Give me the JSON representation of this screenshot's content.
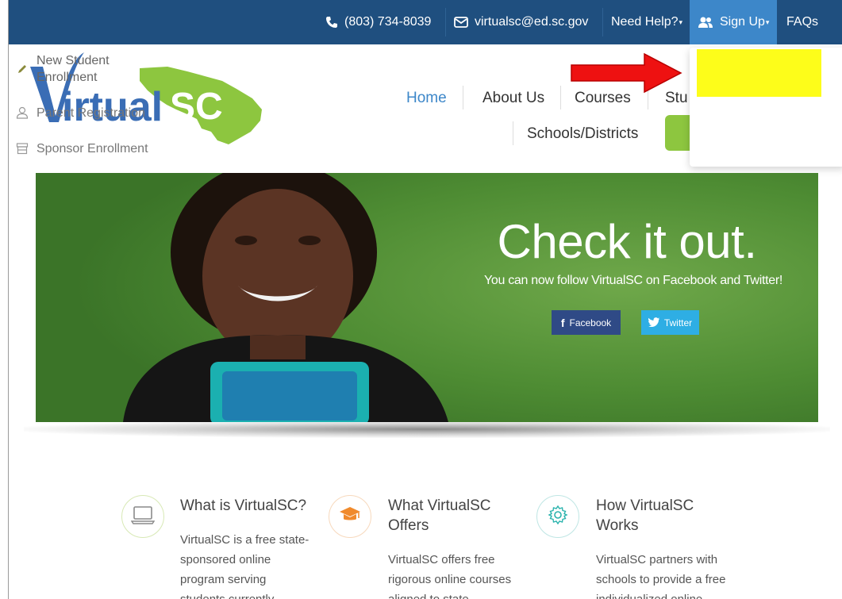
{
  "topbar": {
    "phone": "(803) 734-8039",
    "email": "virtualsc@ed.sc.gov",
    "help": "Need Help?",
    "signup": "Sign Up",
    "faqs": "FAQs"
  },
  "logo": {
    "text_v": "V",
    "text_rest": "irtual",
    "text_sc": "SC"
  },
  "nav": {
    "home": "Home",
    "about": "About Us",
    "courses": "Courses",
    "students": "Stu",
    "schools": "Schools/Districts"
  },
  "dropdown": {
    "new_student": "New Student Enrollment",
    "new_student_l1": "New Student",
    "new_student_l2": "Enrollment",
    "parent": "Parent Registration",
    "sponsor": "Sponsor Enrollment"
  },
  "hero": {
    "title": "Check it out.",
    "subtitle": "You can now follow VirtualSC on Facebook and Twitter!",
    "facebook": "Facebook",
    "twitter": "Twitter"
  },
  "features": [
    {
      "title": "What is VirtualSC?",
      "lines": [
        "VirtualSC is a free state-",
        "sponsored online",
        "program serving",
        "students currently"
      ]
    },
    {
      "title_l1": "What VirtualSC",
      "title_l2": "Offers",
      "lines": [
        "VirtualSC offers free",
        "rigorous online courses",
        "aligned to state"
      ]
    },
    {
      "title_l1": "How VirtualSC",
      "title_l2": "Works",
      "lines": [
        "VirtualSC partners with",
        "schools to provide a free",
        "individualized online"
      ]
    }
  ],
  "colors": {
    "topbar": "#1f4f7f",
    "signup_active": "#3d87c9",
    "logo_blue": "#3a6db5",
    "logo_green": "#8dc63f",
    "highlight": "#fdfd1a",
    "arrow": "#ee1111"
  }
}
